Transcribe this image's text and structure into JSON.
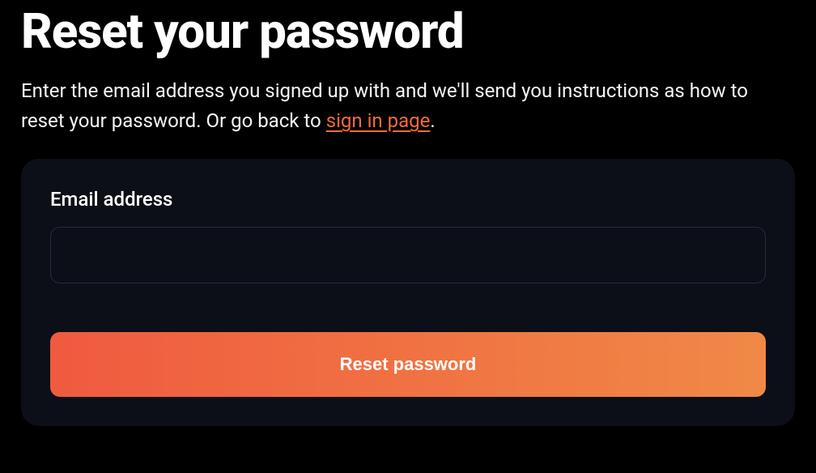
{
  "header": {
    "title": "Reset your password",
    "description_before": "Enter the email address you signed up with and we'll send you instructions as how to reset your password. Or go back to ",
    "signin_link": "sign in page",
    "description_after": "."
  },
  "form": {
    "email_label": "Email address",
    "email_value": "",
    "reset_button": "Reset password"
  }
}
